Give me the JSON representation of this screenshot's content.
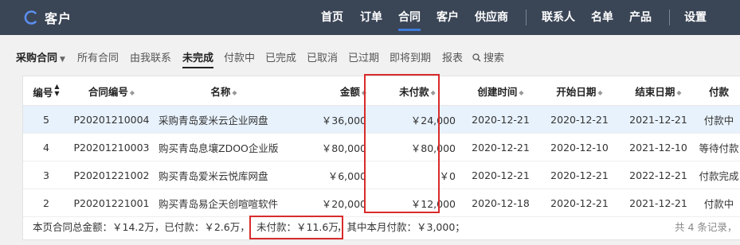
{
  "app": {
    "name": "客户",
    "nav": [
      "首页",
      "订单",
      "合同",
      "客户",
      "供应商",
      "联系人",
      "名单",
      "产品",
      "设置"
    ]
  },
  "subtabs": [
    "采购合同",
    "所有合同",
    "由我联系",
    "未完成",
    "付款中",
    "已完成",
    "已取消",
    "已过期",
    "即将到期",
    "报表",
    "搜索"
  ],
  "table": {
    "headers": [
      "编号",
      "合同编号",
      "名称",
      "金额",
      "未付款",
      "创建时间",
      "开始日期",
      "结束日期",
      "付款"
    ],
    "rows": [
      [
        "5",
        "P20201210004",
        "采购青岛爱米云企业网盘",
        "￥36,000",
        "￥24,000",
        "2020-12-21",
        "2020-12-21",
        "2021-12-21",
        "付款中"
      ],
      [
        "4",
        "P20201210003",
        "购买青岛息壤ZDOO企业版",
        "￥80,000",
        "￥80,000",
        "2020-12-21",
        "2020-12-10",
        "2021-12-10",
        "等待付款"
      ],
      [
        "3",
        "P20201221002",
        "购买青岛爱米云悦库网盘",
        "￥6,000",
        "￥0",
        "2020-12-21",
        "2020-12-21",
        "2022-12-21",
        "付款完成"
      ],
      [
        "2",
        "P20201221001",
        "购买青岛易企天创喧喧软件",
        "￥20,000",
        "￥12,000",
        "2020-12-18",
        "2020-12-21",
        "2021-12-21",
        "付款中"
      ]
    ]
  },
  "summary": {
    "total": "本页合同总金额：￥14.2万，已付款：￥2.6万，",
    "unpaid": "未付款：￥11.6万",
    "month": "，其中本月付款：￥3,000；",
    "count": "共 4 条记录，"
  },
  "colors": {
    "topbar": "#3a4556",
    "accent": "#3d7bd9",
    "highlight": "#d92b2b",
    "selected_row": "#e8f2fc"
  },
  "icons": {
    "brand": "crescent-c-logo",
    "search": "search-icon",
    "dropdown": "caret-down-icon",
    "sort": "sort-icon"
  }
}
